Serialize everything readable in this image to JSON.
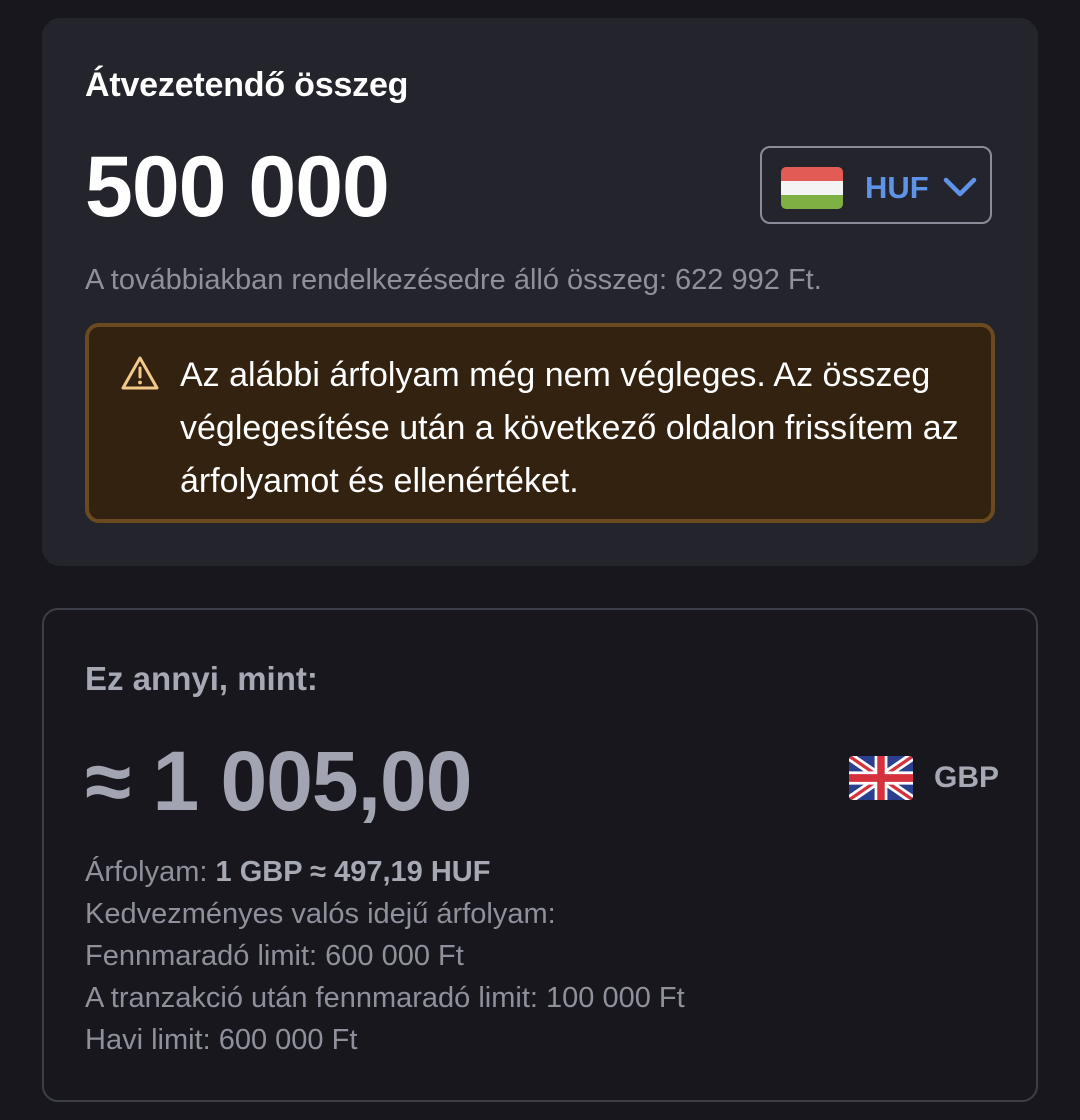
{
  "transfer": {
    "title": "Átvezetendő összeg",
    "amount": "500 000",
    "currency": {
      "code": "HUF",
      "flag_icon": "hungary-flag-icon",
      "accent_color": "#5f93e8"
    },
    "available_text": "A továbbiakban rendelkezésedre álló összeg: 622 992 Ft.",
    "warning": {
      "icon": "warning-triangle-icon",
      "text": "Az alábbi árfolyam még nem végleges. Az összeg véglegesítése után a következő oldalon frissítem az árfolyamot és ellenértéket.",
      "border_color": "#6a4a1e",
      "background_color": "#32220f"
    }
  },
  "conversion": {
    "subtitle": "Ez annyi, mint:",
    "amount": "≈ 1 005,00",
    "currency": {
      "code": "GBP",
      "flag_icon": "uk-flag-icon"
    },
    "rate_label": "Árfolyam:",
    "rate_value": "1 GBP ≈ 497,19 HUF",
    "preferential_rate": "Kedvezményes valós idejű árfolyam:",
    "remaining_limit": "Fennmaradó limit: 600 000 Ft",
    "remaining_after": "A tranzakció után fennmaradó limit: 100 000 Ft",
    "monthly_limit": "Havi limit: 600 000 Ft"
  }
}
